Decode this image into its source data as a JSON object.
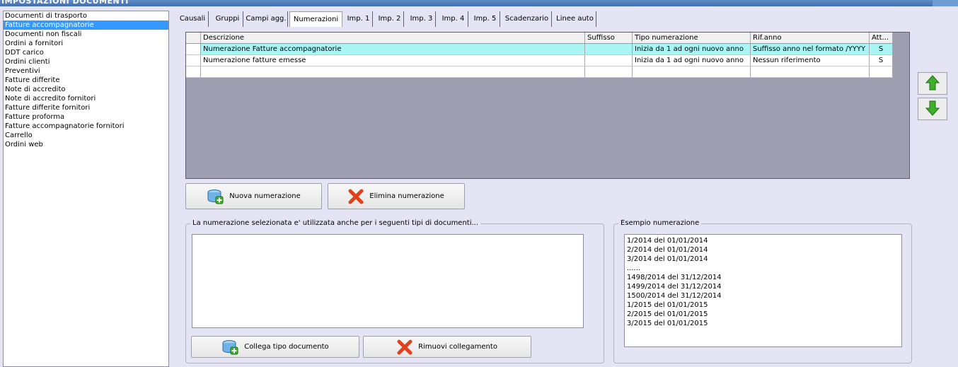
{
  "window": {
    "title": "IMPOSTAZIONI DOCUMENTI"
  },
  "doc_types": [
    "Documenti di trasporto",
    "Fatture accompagnatorie",
    "Documenti non fiscali",
    "Ordini a fornitori",
    "DDT carico",
    "Ordini clienti",
    "Preventivi",
    "Fatture differite",
    "Note di accredito",
    "Note di accredito fornitori",
    "Fatture differite fornitori",
    "Fatture proforma",
    "Fatture accompagnatorie fornitori",
    "Carrello",
    "Ordini web"
  ],
  "selected_doc_type": "Fatture accompagnatorie",
  "tabs": [
    "Causali",
    "Gruppi",
    "Campi agg.",
    "Numerazioni",
    "Imp. 1",
    "Imp. 2",
    "Imp. 3",
    "Imp. 4",
    "Imp. 5",
    "Scadenzario",
    "Linee auto"
  ],
  "active_tab": "Numerazioni",
  "grid": {
    "columns": [
      "Descrizione",
      "Suffisso",
      "Tipo numerazione",
      "Rif.anno",
      "Att..."
    ],
    "rows": [
      {
        "descrizione": "Numerazione Fatture accompagnatorie",
        "suffisso": "",
        "tipo": "Inizia da 1 ad ogni nuovo anno",
        "rif_anno": "Suffisso anno nel formato /YYYY",
        "att": "S"
      },
      {
        "descrizione": "Numerazione fatture emesse",
        "suffisso": "",
        "tipo": "Inizia da 1 ad ogni nuovo anno",
        "rif_anno": "Nessun riferimento",
        "att": "S"
      }
    ]
  },
  "buttons": {
    "new_numbering": "Nuova numerazione",
    "delete_numbering": "Elimina numerazione",
    "link_doc_type": "Collega tipo documento",
    "remove_link": "Rimuovi collegamento"
  },
  "linked_docs_group": {
    "label": "La numerazione selezionata e' utilizzata anche per i seguenti tipi di documenti..."
  },
  "example_group": {
    "label": "Esempio numerazione",
    "lines": [
      "1/2014 del 01/01/2014",
      "2/2014 del 01/01/2014",
      "3/2014 del 01/01/2014",
      "......",
      "1498/2014 del 31/12/2014",
      "1499/2014 del 31/12/2014",
      "1500/2014 del 31/12/2014",
      "1/2015 del 01/01/2015",
      "2/2015 del 01/01/2015",
      "3/2015 del 01/01/2015"
    ]
  },
  "colors": {
    "selection": "#3399ff",
    "grid_selected_row": "#a9f5f5",
    "grid_background": "#9e9eb0",
    "window_background": "#e4e4f4",
    "arrow_green": "#3fae2a",
    "delete_red": "#e2401c"
  },
  "icons": {
    "move_up": "arrow-up-icon",
    "move_down": "arrow-down-icon",
    "new": "add-database-icon",
    "delete": "red-x-icon",
    "link": "add-database-icon",
    "remove": "red-x-icon"
  }
}
